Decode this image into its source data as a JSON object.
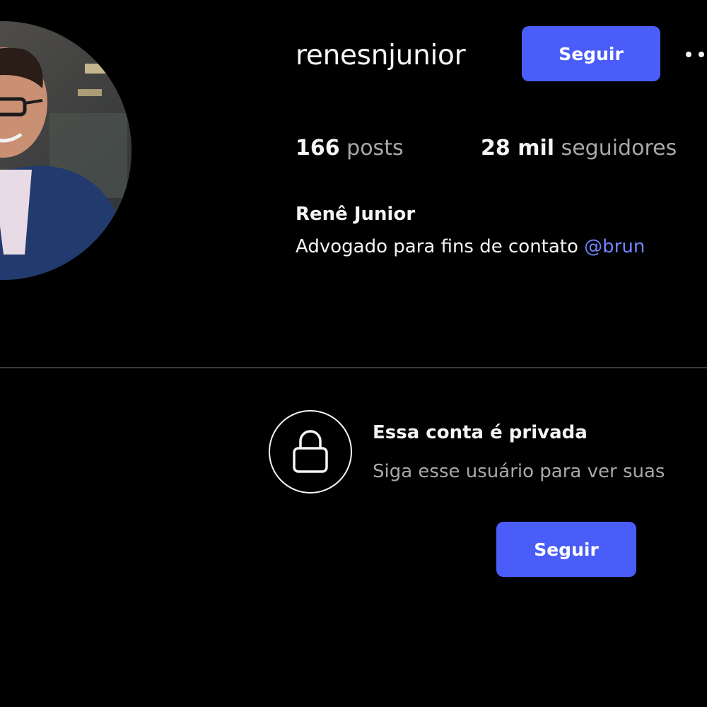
{
  "profile": {
    "username": "renesnjunior",
    "full_name": "Renê Junior",
    "bio_text": "Advogado para fins de contato ",
    "bio_mention": "@brun",
    "avatar_icon": "profile-photo"
  },
  "header": {
    "follow_label": "Seguir",
    "more_icon": "more-options-icon"
  },
  "stats": {
    "posts_count": "166",
    "posts_label": " posts",
    "followers_count": "28 mil",
    "followers_label": " seguidores"
  },
  "private_account": {
    "icon": "lock-icon",
    "title": "Essa conta é privada",
    "subtitle": "Siga esse usuário para ver suas",
    "follow_label": "Seguir"
  },
  "colors": {
    "background": "#000000",
    "accent": "#4a5df9",
    "mention": "#7084ff",
    "secondary_text": "#a8a8a8",
    "divider": "#3a3a3a"
  }
}
